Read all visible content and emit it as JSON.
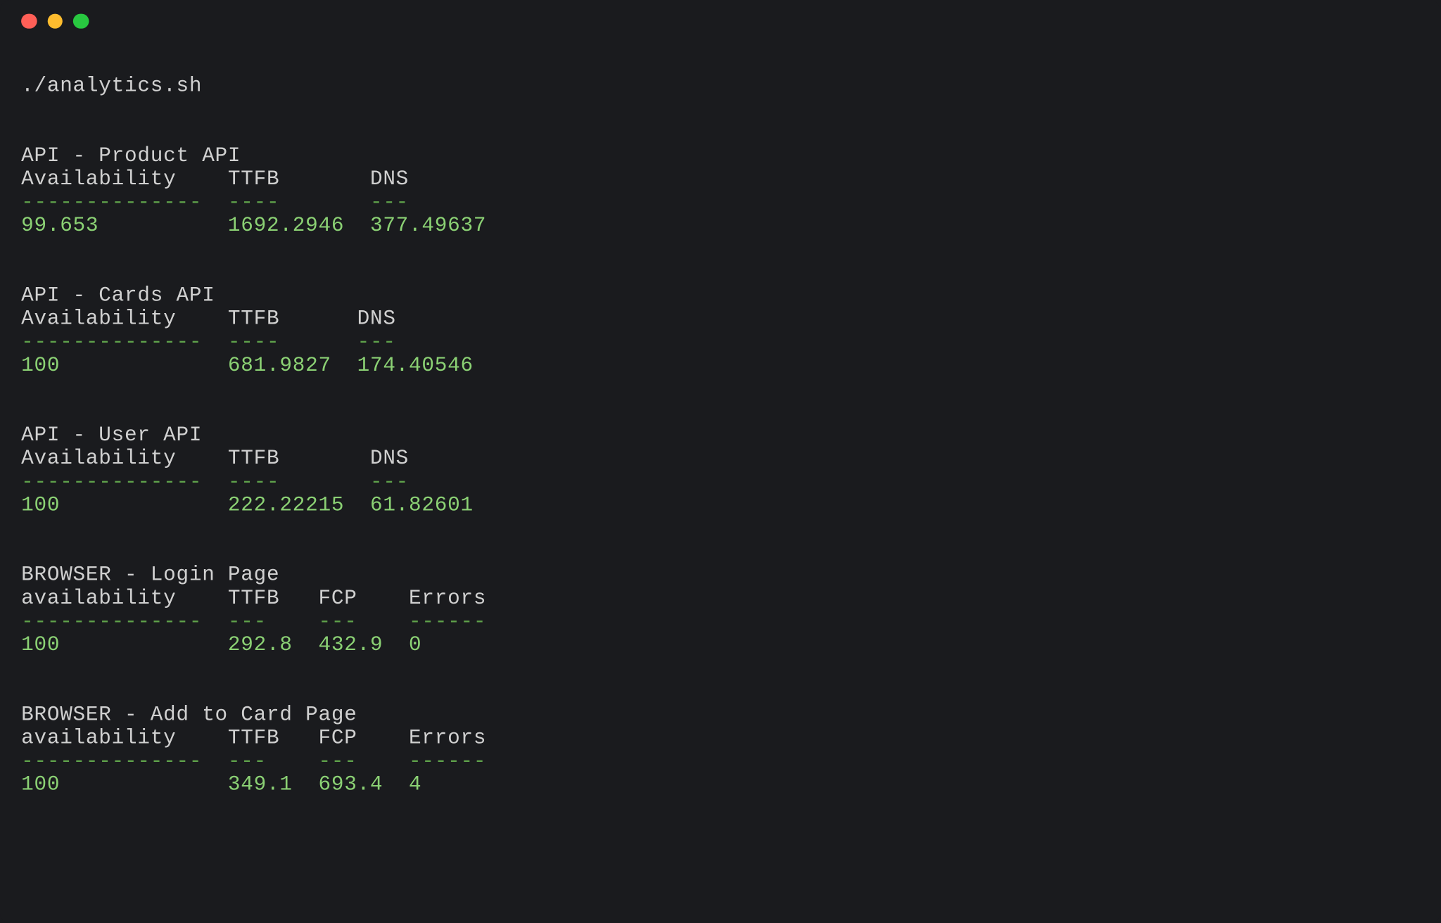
{
  "command": "./analytics.sh",
  "sections": [
    {
      "title": "API - Product API",
      "headers": [
        "Availability",
        "TTFB",
        "DNS"
      ],
      "widths": [
        14,
        9,
        9
      ],
      "dashes": [
        14,
        4,
        3
      ],
      "values": [
        "99.653",
        "1692.2946",
        "377.49637"
      ]
    },
    {
      "title": "API - Cards API",
      "headers": [
        "Availability",
        "TTFB",
        "DNS"
      ],
      "widths": [
        14,
        8,
        9
      ],
      "dashes": [
        14,
        4,
        3
      ],
      "values": [
        "100",
        "681.9827",
        "174.40546"
      ]
    },
    {
      "title": "API - User API",
      "headers": [
        "Availability",
        "TTFB",
        "DNS"
      ],
      "widths": [
        14,
        9,
        8
      ],
      "dashes": [
        14,
        4,
        3
      ],
      "values": [
        "100",
        "222.22215",
        "61.82601"
      ]
    },
    {
      "title": "BROWSER - Login Page",
      "headers": [
        "availability",
        "TTFB",
        "FCP",
        "Errors"
      ],
      "widths": [
        14,
        5,
        5,
        6
      ],
      "dashes": [
        14,
        3,
        3,
        6
      ],
      "values": [
        "100",
        "292.8",
        "432.9",
        "0"
      ]
    },
    {
      "title": "BROWSER - Add to Card Page",
      "headers": [
        "availability",
        "TTFB",
        "FCP",
        "Errors"
      ],
      "widths": [
        14,
        5,
        5,
        6
      ],
      "dashes": [
        14,
        3,
        3,
        6
      ],
      "values": [
        "100",
        "349.1",
        "693.4",
        "4"
      ]
    }
  ]
}
